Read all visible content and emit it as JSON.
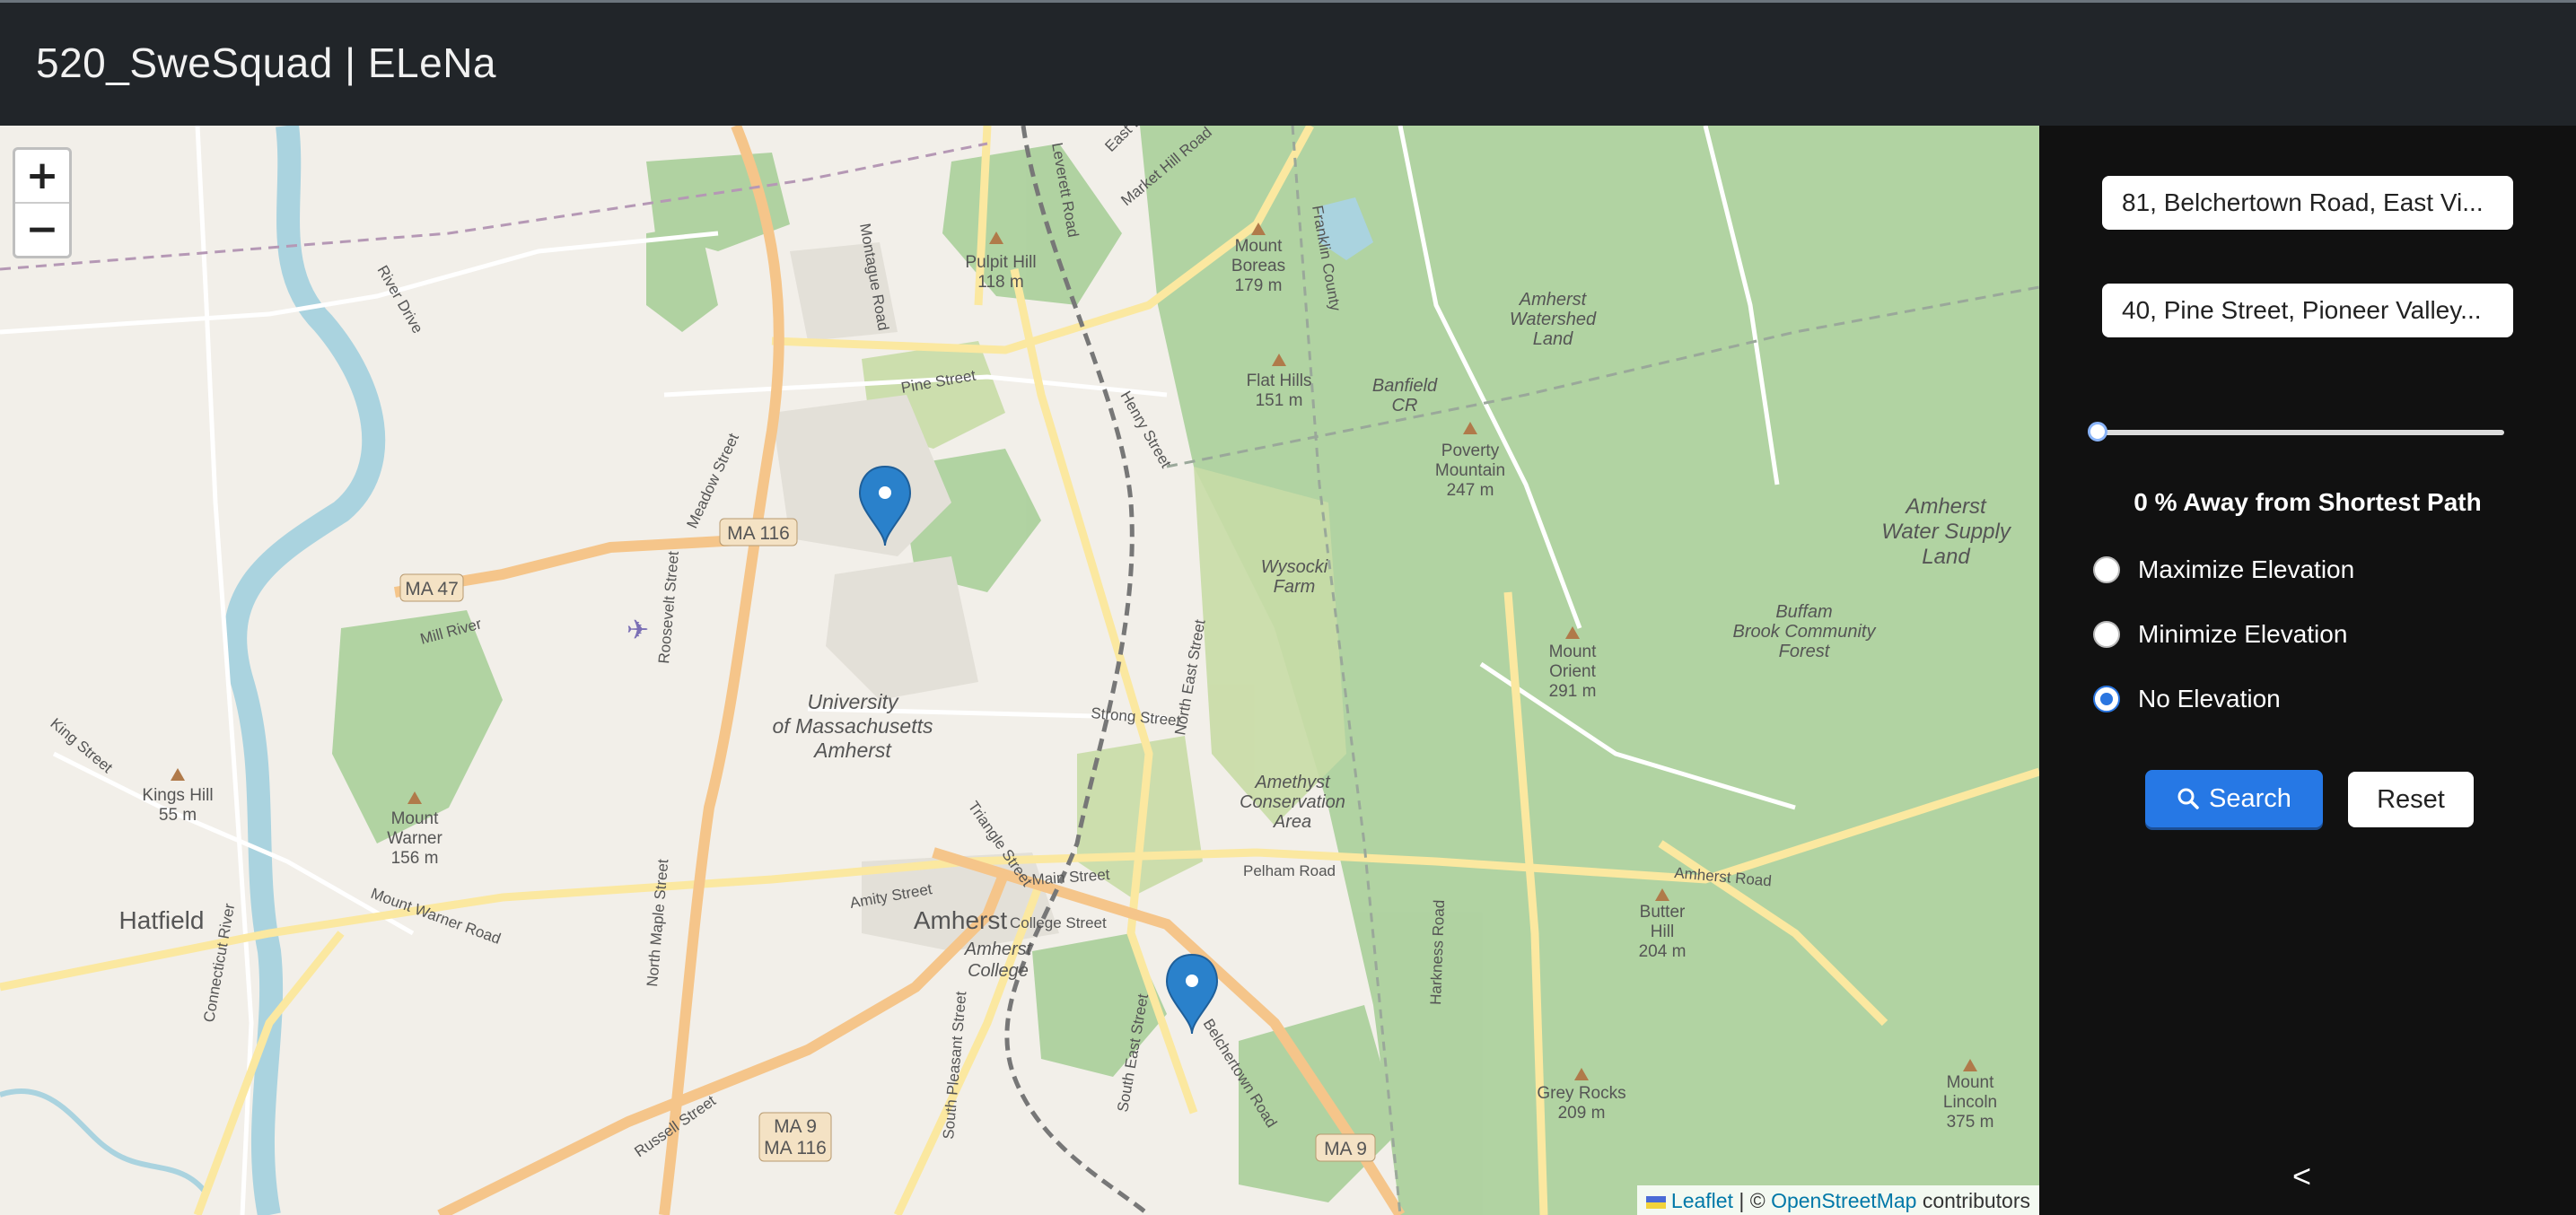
{
  "app": {
    "title": "520_SweSquad | ELeNa"
  },
  "map": {
    "zoom_in": "+",
    "zoom_out": "−",
    "attribution": {
      "leaflet": "Leaflet",
      "sep": " | © ",
      "osm": "OpenStreetMap",
      "contributors": " contributors"
    },
    "labels": {
      "hatfield": "Hatfield",
      "amherst": "Amherst",
      "umass1": "University",
      "umass2": "of Massachusetts",
      "umass3": "Amherst",
      "amherst_college1": "Amherst",
      "amherst_college2": "College",
      "pulpit_hill": "Pulpit Hill",
      "pulpit_hill_h": "118 m",
      "mount_boreas": "Mount",
      "mount_boreas2": "Boreas",
      "mount_boreas_h": "179 m",
      "flat_hills": "Flat Hills",
      "flat_hills_h": "151 m",
      "poverty1": "Poverty",
      "poverty2": "Mountain",
      "poverty_h": "247 m",
      "mount_orient1": "Mount",
      "mount_orient2": "Orient",
      "mount_orient_h": "291 m",
      "amherst_watershed1": "Amherst",
      "amherst_watershed2": "Watershed",
      "amherst_watershed3": "Land",
      "water_supply1": "Amherst",
      "water_supply2": "Water Supply",
      "water_supply3": "Land",
      "buffam1": "Buffam",
      "buffam2": "Brook Community",
      "buffam3": "Forest",
      "amethyst1": "Amethyst",
      "amethyst2": "Conservation",
      "amethyst3": "Area",
      "wysocki1": "Wysocki",
      "wysocki2": "Farm",
      "butter1": "Butter",
      "butter2": "Hill",
      "butter_h": "204 m",
      "grey_rocks": "Grey Rocks",
      "grey_rocks_h": "209 m",
      "mount_lincoln1": "Mount",
      "mount_lincoln2": "Lincoln",
      "mount_lincoln_h": "375 m",
      "kings_hill": "Kings Hill",
      "kings_hill_h": "55 m",
      "mount_warner1": "Mount",
      "mount_warner2": "Warner",
      "mount_warner_h": "156 m",
      "banfield1": "Banfield",
      "banfield2": "CR",
      "ma116": "MA 116",
      "ma47": "MA 47",
      "ma9a": "MA 9",
      "ma9b": "MA 116",
      "ma9c": "MA 9",
      "pine_street": "Pine Street",
      "strong_street": "Strong Street",
      "main_street": "Main Street",
      "college_street": "College Street",
      "amity_street": "Amity Street",
      "pelham_road": "Pelham Road",
      "amherst_road": "Amherst Road",
      "triangle_street": "Triangle Street",
      "north_east_street": "North East Street",
      "south_east_street": "South East Street",
      "south_pleasant": "South Pleasant Street",
      "north_maple": "North Maple Street",
      "russell_street": "Russell Street",
      "mount_warner_road": "Mount Warner Road",
      "river_drive": "River Drive",
      "meadow_street": "Meadow Street",
      "montague_road": "Montague Road",
      "roosevelt_street": "Roosevelt Street",
      "king_street": "King Street",
      "mill_river": "Mill River",
      "connecticut_river": "Connecticut River",
      "market_hill": "Market Hill Road",
      "east_leverett": "East Leverett Road",
      "leverett_road": "Leverett Road",
      "henry_street": "Henry Street",
      "harkness_road": "Harkness Road",
      "belchertown": "Belchertown Road",
      "franklin_county": "Franklin County"
    }
  },
  "sidebar": {
    "start_value": "81, Belchertown Road, East Vi...",
    "end_value": "40, Pine Street, Pioneer Valley...",
    "slider_percent": 0,
    "slider_label": "0 % Away from Shortest Path",
    "options": [
      {
        "label": "Maximize Elevation",
        "selected": false
      },
      {
        "label": "Minimize Elevation",
        "selected": false
      },
      {
        "label": "No Elevation",
        "selected": true
      }
    ],
    "search_label": "Search",
    "reset_label": "Reset",
    "collapse_glyph": "<"
  },
  "colors": {
    "accent": "#2678e5",
    "forest": "#add19e",
    "road_major": "#f5c58a",
    "water": "#aad3df",
    "marker": "#2a81cb"
  }
}
